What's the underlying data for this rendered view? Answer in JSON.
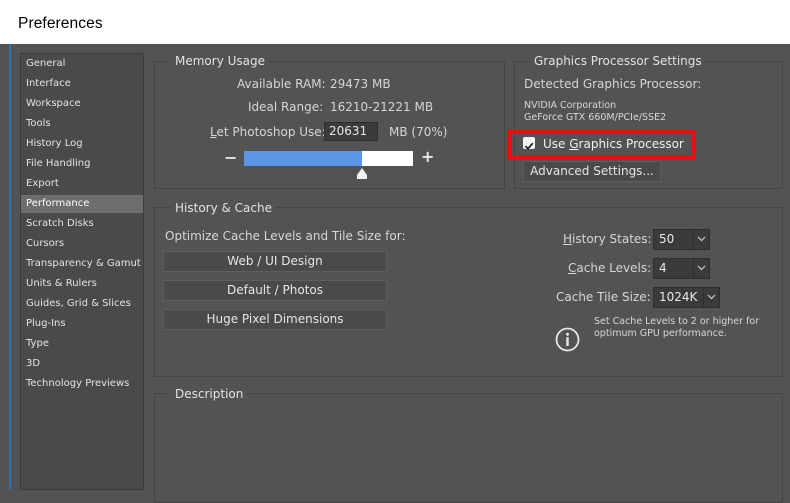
{
  "window": {
    "title": "Preferences"
  },
  "sidebar": {
    "items": [
      {
        "label": "General"
      },
      {
        "label": "Interface"
      },
      {
        "label": "Workspace"
      },
      {
        "label": "Tools"
      },
      {
        "label": "History Log"
      },
      {
        "label": "File Handling"
      },
      {
        "label": "Export"
      },
      {
        "label": "Performance",
        "selected": true
      },
      {
        "label": "Scratch Disks"
      },
      {
        "label": "Cursors"
      },
      {
        "label": "Transparency & Gamut"
      },
      {
        "label": "Units & Rulers"
      },
      {
        "label": "Guides, Grid & Slices"
      },
      {
        "label": "Plug-Ins"
      },
      {
        "label": "Type"
      },
      {
        "label": "3D"
      },
      {
        "label": "Technology Previews"
      }
    ]
  },
  "memory": {
    "title": "Memory Usage",
    "available_label": "Available RAM:",
    "available_value": "29473 MB",
    "ideal_label": "Ideal Range:",
    "ideal_value": "16210-21221 MB",
    "let_label_prefix": "",
    "let_label_key": "L",
    "let_label_rest": "et Photoshop Use:",
    "let_value": "20631",
    "let_unit": "MB (70%)",
    "minus": "−",
    "plus": "+",
    "usage_fraction": 0.7
  },
  "gpu": {
    "title": "Graphics Processor Settings",
    "detected_label": "Detected Graphics Processor:",
    "vendor": "NVIDIA Corporation",
    "model": "GeForce GTX 660M/PCIe/SSE2",
    "use_label_pre": "Use ",
    "use_label_key": "G",
    "use_label_rest": "raphics Processor",
    "use_checked": true,
    "advanced_button": "Advanced Settings...",
    "highlight_color": "#e31010"
  },
  "history": {
    "title": "History & Cache",
    "optimize_label": "Optimize Cache Levels and Tile Size for:",
    "buttons": [
      "Web / UI Design",
      "Default / Photos",
      "Huge Pixel Dimensions"
    ],
    "states_label_key": "H",
    "states_label_rest": "istory States:",
    "states_value": "50",
    "levels_label_pre": "",
    "levels_label_key": "C",
    "levels_label_rest": "ache Levels:",
    "levels_value": "4",
    "tile_label": "Cache Tile Size:",
    "tile_value": "1024K",
    "info_line1": "Set Cache Levels to 2 or higher for",
    "info_line2": "optimum GPU performance."
  },
  "description": {
    "title": "Description"
  },
  "colors": {
    "background": "#535353",
    "accent_fill": "#5a95e6",
    "selected_item": "#6d6d6d"
  }
}
